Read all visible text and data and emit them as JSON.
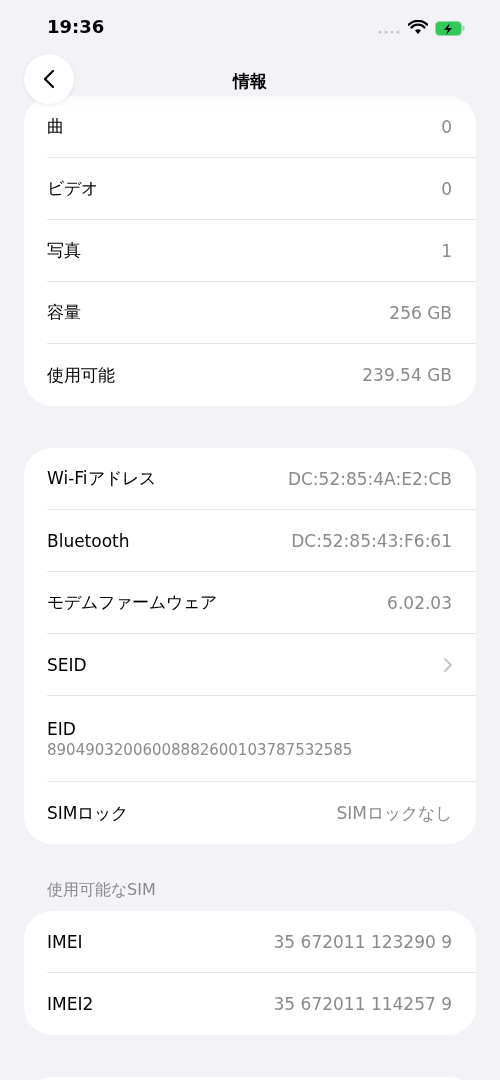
{
  "status_bar": {
    "time": "19:36"
  },
  "nav": {
    "title": "情報"
  },
  "sections": [
    {
      "rows": [
        {
          "kind": "value",
          "label": "曲",
          "value": "0"
        },
        {
          "kind": "value",
          "label": "ビデオ",
          "value": "0"
        },
        {
          "kind": "value",
          "label": "写真",
          "value": "1"
        },
        {
          "kind": "value",
          "label": "容量",
          "value": "256 GB"
        },
        {
          "kind": "value",
          "label": "使用可能",
          "value": "239.54 GB"
        }
      ]
    },
    {
      "rows": [
        {
          "kind": "value",
          "label": "Wi-Fiアドレス",
          "value": "DC:52:85:4A:E2:CB"
        },
        {
          "kind": "value",
          "label": "Bluetooth",
          "value": "DC:52:85:43:F6:61"
        },
        {
          "kind": "value",
          "label": "モデムファームウェア",
          "value": "6.02.03"
        },
        {
          "kind": "chevron",
          "label": "SEID"
        },
        {
          "kind": "stacked",
          "label": "EID",
          "value": "89049032006008882600103787532585"
        },
        {
          "kind": "value",
          "label": "SIMロック",
          "value": "SIMロックなし"
        }
      ]
    },
    {
      "header": "使用可能なSIM",
      "rows": [
        {
          "kind": "value",
          "label": "IMEI",
          "value": "35 672011 123290 9"
        },
        {
          "kind": "value",
          "label": "IMEI2",
          "value": "35 672011 114257 9"
        }
      ]
    },
    {
      "kind": "partial"
    }
  ]
}
